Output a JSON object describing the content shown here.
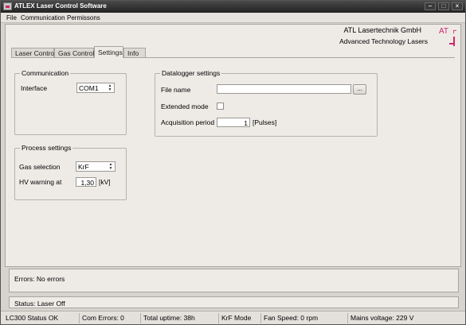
{
  "window": {
    "title": "ATLEX Laser Control Software"
  },
  "menu": [
    "File",
    "Communication",
    "Permissons"
  ],
  "brand": {
    "name": "ATL Lasertechnik GmbH",
    "tagline": "Advanced Technology Lasers",
    "logo_text": "ATL",
    "color": "#d0256c"
  },
  "tabs": [
    {
      "label": "Laser Control",
      "active": false
    },
    {
      "label": "Gas Control",
      "active": false
    },
    {
      "label": "Settings",
      "active": true
    },
    {
      "label": "Info",
      "active": false
    }
  ],
  "communication": {
    "title": "Communication",
    "interface_label": "Interface",
    "interface_value": "COM1"
  },
  "process": {
    "title": "Process settings",
    "gas_label": "Gas selection",
    "gas_value": "KrF",
    "hv_label": "HV warning at",
    "hv_value": "1,30",
    "hv_unit": "[kV]"
  },
  "datalogger": {
    "title": "Datalogger settings",
    "file_label": "File name",
    "file_value": "",
    "browse_label": "...",
    "extended_label": "Extended mode",
    "extended_checked": false,
    "period_label": "Acquisition period",
    "period_value": "1",
    "period_unit": "[Pulses]"
  },
  "errors_text": "Errors: No errors",
  "status_text": "Status: Laser Off",
  "statusbar": [
    "LC300 Status OK",
    "Com Errors: 0",
    "Total uptime: 38h",
    "KrF Mode",
    "Fan Speed: 0 rpm",
    "Mains voltage: 229 V"
  ]
}
